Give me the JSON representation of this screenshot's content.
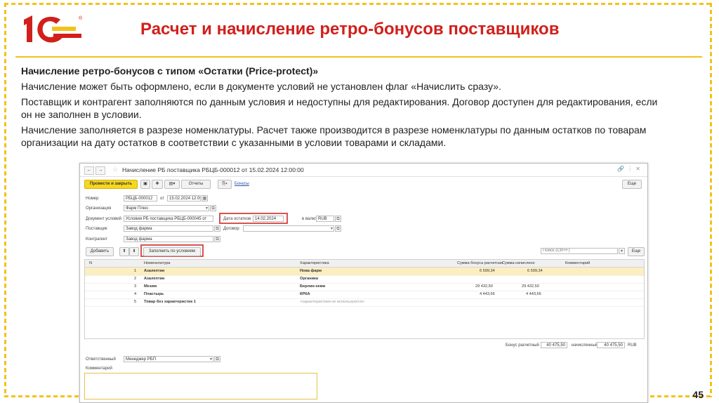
{
  "slide": {
    "title": "Расчет и начисление ретро-бонусов поставщиков",
    "subtitle": "Начисление ретро-бонусов с типом «Остатки (Price-protect)»",
    "paragraphs": [
      "Начисление может быть оформлено, если в документе условий не установлен флаг «Начислить сразу».",
      "Поставщик и контрагент заполняются по данным условия и недоступны для редактирования. Договор доступен для редактирования, если он не заполнен в условии.",
      "Начисление заполняется в разрезе номенклатуры. Расчет также производится в разрезе номенклатуры по данным остатков по товарам организации на дату остатков в соответствии с указанными в условии товарами и складами."
    ],
    "page_number": "45",
    "accent_color": "#d1201c",
    "frame_color": "#f3c21a"
  },
  "logo": {
    "text": "1С",
    "mark": "®"
  },
  "window": {
    "title": "Начисление РБ поставщика РБЦБ-000012 от 15.02.2024 12:00:00",
    "toolbar": {
      "post_close": "Провести и закрыть",
      "reports": "Отчеты",
      "bonus_link": "Бонусы",
      "more": "Еще"
    },
    "form": {
      "number_label": "Номер",
      "number_value": "РБЦБ-000012",
      "from_label": "от",
      "date_value": "15.02.2024 12:00:00",
      "org_label": "Организация",
      "org_value": "Фарм Плюс",
      "conditions_label": "Документ условий",
      "conditions_value": "Условия РБ поставщика РБЦБ-000045 от",
      "stock_date_label": "Дата остатков",
      "stock_date_value": "14.02.2024",
      "currency_label": "в валюте",
      "currency_value": "RUB",
      "supplier_label": "Поставщик",
      "supplier_value": "Завод фарма",
      "contract_label": "Договор",
      "contract_value": "",
      "counterparty_label": "Контрагент",
      "counterparty_value": "Завод фарма"
    },
    "table_toolbar": {
      "add": "Добавить",
      "fill": "Заполнить по условиям",
      "search_placeholder": "Поиск (Ctrl+F)",
      "more": "Еще"
    },
    "columns": [
      "N",
      "Номенклатура",
      "Характеристика",
      "Сумма бонуса расчетная",
      "Сумма начислено",
      "Комментарий"
    ],
    "rows": [
      {
        "n": "1",
        "item": "Азалептин",
        "char": "Нова фарм",
        "calc": "6 599,34",
        "accrued": "6 599,34"
      },
      {
        "n": "2",
        "item": "Азалептин",
        "char": "Органика",
        "calc": "",
        "accrued": ""
      },
      {
        "n": "3",
        "item": "Мезим",
        "char": "Берлин-хеми",
        "calc": "29 432,50",
        "accrued": "29 432,50"
      },
      {
        "n": "4",
        "item": "Пластырь",
        "char": "КРКА",
        "calc": "4 443,66",
        "accrued": "4 443,66"
      },
      {
        "n": "5",
        "item": "Товар без характеристик 1",
        "char": "<характеристики не используются>",
        "calc": "",
        "accrued": ""
      }
    ],
    "totals": {
      "calc_label": "Бонус расчетный",
      "calc_value": "40 475,50",
      "accrued_label": "начисленный",
      "accrued_value": "40 475,50",
      "currency": "RUB"
    },
    "footer": {
      "responsible_label": "Ответственный",
      "responsible_value": "Менеджер РБП",
      "comment_label": "Комментарий"
    }
  }
}
